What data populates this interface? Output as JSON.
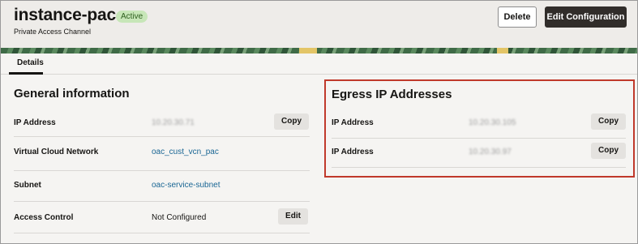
{
  "header": {
    "title": "instance-pac",
    "status_badge": "Active",
    "subtitle": "Private Access Channel",
    "delete_label": "Delete",
    "edit_config_label": "Edit Configuration"
  },
  "tabs": [
    {
      "label": "Details",
      "active": true
    }
  ],
  "general": {
    "title": "General information",
    "rows": [
      {
        "label": "IP Address",
        "value": "10.20.30.71",
        "action": "Copy"
      },
      {
        "label": "Virtual Cloud Network",
        "value": "oac_cust_vcn_pac"
      },
      {
        "label": "Subnet",
        "value": "oac-service-subnet"
      },
      {
        "label": "Access Control",
        "value": "Not Configured",
        "action": "Edit"
      }
    ]
  },
  "egress": {
    "title": "Egress IP Addresses",
    "rows": [
      {
        "label": "IP Address",
        "value": "10.20.30.105",
        "action": "Copy"
      },
      {
        "label": "IP Address",
        "value": "10.20.30.97",
        "action": "Copy"
      }
    ]
  },
  "colors": {
    "primary_button": "#312d2a",
    "active_badge": "#c7e6b8",
    "link": "#1a6694",
    "highlight_border": "#c0392b"
  }
}
